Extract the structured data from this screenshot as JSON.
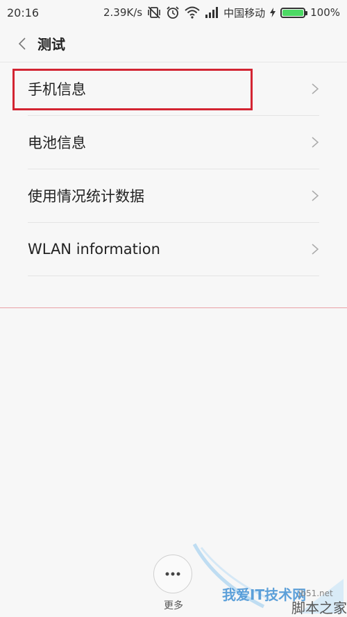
{
  "status_bar": {
    "time": "20:16",
    "speed": "2.39K/s",
    "carrier": "中国移动",
    "battery_percent": "100%",
    "battery_level": 1.0
  },
  "header": {
    "title": "测试"
  },
  "list": {
    "items": [
      {
        "label": "手机信息"
      },
      {
        "label": "电池信息"
      },
      {
        "label": "使用情况统计数据"
      },
      {
        "label": "WLAN information"
      }
    ]
  },
  "footer": {
    "more_label": "更多"
  },
  "watermark": {
    "text": "我爱IT技术网",
    "site": "jb51.net",
    "brand": "脚本之家"
  },
  "colors": {
    "highlight": "#d32432",
    "battery": "#4cd964"
  }
}
